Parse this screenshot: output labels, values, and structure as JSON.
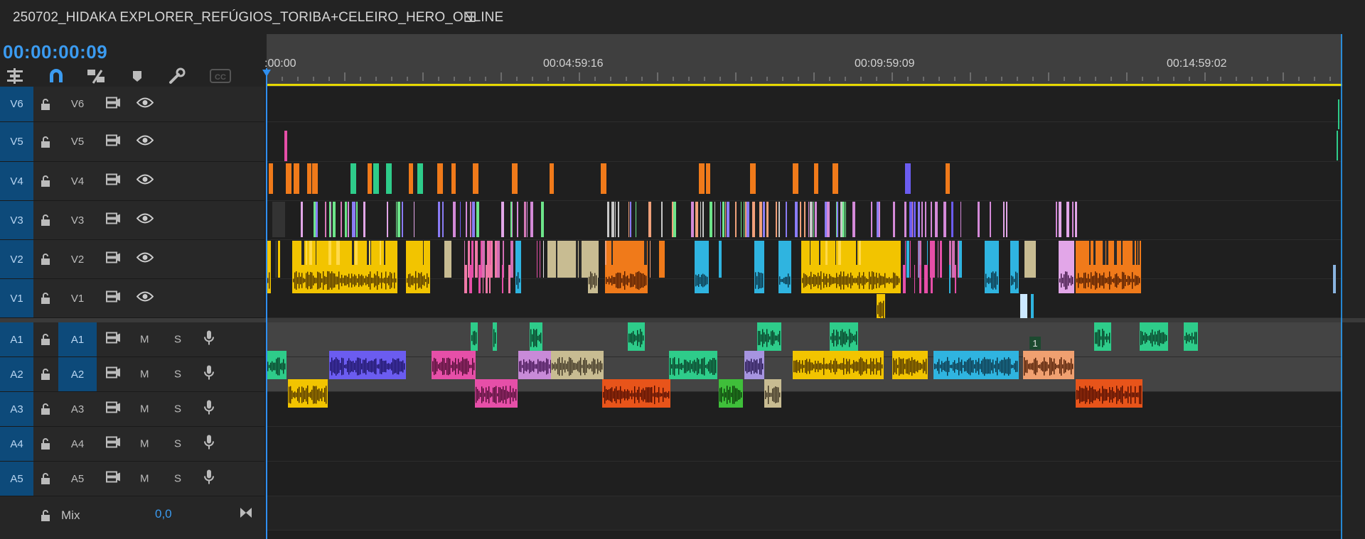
{
  "sequence": {
    "title": "250702_HIDAKA EXPLORER_REFÚGIOS_TORIBA+CELEIRO_HERO_ONLINE",
    "menu_icon": "hamburger-menu-icon"
  },
  "timecode": "00:00:00:09",
  "toolbar": {
    "tools": [
      "insert-nest-icon",
      "snap-magnet-icon",
      "linked-selection-icon",
      "add-marker-icon",
      "settings-wrench-icon",
      "captions-cc-icon"
    ],
    "cc_label": "CC"
  },
  "ruler": {
    "labels": [
      ":00:00",
      "00:04:59:16",
      "00:09:59:09",
      "00:14:59:02"
    ],
    "workarea_color": "#e6d800"
  },
  "video_tracks": [
    {
      "target": "V6",
      "source": "V6"
    },
    {
      "target": "V5",
      "source": "V5"
    },
    {
      "target": "V4",
      "source": "V4"
    },
    {
      "target": "V3",
      "source": "V3"
    },
    {
      "target": "V2",
      "source": "V2"
    },
    {
      "target": "V1",
      "source": "V1"
    }
  ],
  "audio_tracks": [
    {
      "target": "A1",
      "source": "A1",
      "m": "M",
      "s": "S"
    },
    {
      "target": "A2",
      "source": "A2",
      "m": "M",
      "s": "S"
    },
    {
      "target": "A3",
      "source": "A3",
      "m": "M",
      "s": "S"
    },
    {
      "target": "A4",
      "source": "A4",
      "m": "M",
      "s": "S"
    },
    {
      "target": "A5",
      "source": "A5",
      "m": "M",
      "s": "S"
    }
  ],
  "mix": {
    "label": "Mix",
    "value": "0,0"
  },
  "marker_label": "1",
  "colors": {
    "accent": "#3b9bf0",
    "target_on": "#0d4a7a",
    "yellow": "#f2c400",
    "orange": "#f07a1a",
    "green": "#2ecc8a",
    "purple": "#6b5cf0",
    "pink": "#e64fa8",
    "cyan": "#2fb4e0",
    "tan": "#c8bc92"
  }
}
